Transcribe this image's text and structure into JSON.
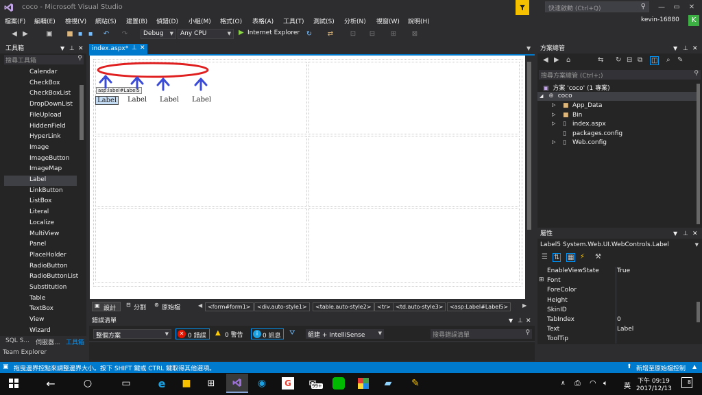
{
  "title": {
    "app": "coco - Microsoft Visual Studio",
    "quick_launch": "快速啟動 (Ctrl+Q)",
    "user": "kevin-16880",
    "user_initial": "K"
  },
  "menu": [
    "檔案(F)",
    "編輯(E)",
    "檢視(V)",
    "網站(S)",
    "建置(B)",
    "偵錯(D)",
    "小組(M)",
    "格式(O)",
    "表格(A)",
    "工具(T)",
    "測試(S)",
    "分析(N)",
    "視窗(W)",
    "說明(H)"
  ],
  "toolbar": {
    "config": "Debug",
    "platform": "Any CPU",
    "run": "Internet Explorer"
  },
  "toolbox": {
    "title": "工具箱",
    "search": "搜尋工具箱",
    "items": [
      "Calendar",
      "CheckBox",
      "CheckBoxList",
      "DropDownList",
      "FileUpload",
      "HiddenField",
      "HyperLink",
      "Image",
      "ImageButton",
      "ImageMap",
      "Label",
      "LinkButton",
      "ListBox",
      "Literal",
      "Localize",
      "MultiView",
      "Panel",
      "PlaceHolder",
      "RadioButton",
      "RadioButtonList",
      "Substitution",
      "Table",
      "TextBox",
      "View",
      "Wizard"
    ],
    "selected": "Label",
    "bottom_tabs": [
      "SQL S...",
      "伺服器...",
      "工具箱"
    ]
  },
  "editor": {
    "tab": "index.aspx*",
    "tag_label": "asp:label#Label5",
    "labels": [
      "Label",
      "Label",
      "Label",
      "Label"
    ],
    "view_tabs": [
      "設計",
      "分割",
      "原始檔"
    ],
    "breadcrumbs": [
      "<form#form1>",
      "<div.auto-style1>",
      "<table.auto-style2>",
      "<tr>",
      "<td.auto-style3>",
      "<asp:Label#Label5>"
    ]
  },
  "error_list": {
    "title": "錯誤清單",
    "scope": "整個方案",
    "errors": "0 錯誤",
    "warnings": "0 警告",
    "messages": "0 訊息",
    "build": "組建 + IntelliSense",
    "search": "搜尋錯誤清單"
  },
  "solution": {
    "title": "方案總管",
    "search": "搜尋方案總管 (Ctrl+;)",
    "root": "方案 'coco' (1 專案)",
    "project": "coco",
    "items": [
      "App_Data",
      "Bin",
      "index.aspx",
      "packages.config",
      "Web.config"
    ]
  },
  "properties": {
    "title": "屬性",
    "object": "Label5  System.Web.UI.WebControls.Label",
    "rows": [
      {
        "name": "EnableViewState",
        "value": "True"
      },
      {
        "name": "Font",
        "value": ""
      },
      {
        "name": "ForeColor",
        "value": ""
      },
      {
        "name": "Height",
        "value": ""
      },
      {
        "name": "SkinID",
        "value": ""
      },
      {
        "name": "TabIndex",
        "value": "0"
      },
      {
        "name": "Text",
        "value": "Label"
      },
      {
        "name": "ToolTip",
        "value": ""
      }
    ]
  },
  "team_explorer": "Team Explorer",
  "status": {
    "left": "拖曳邊界控點來調整邊界大小。按下 SHIFT 鍵或 CTRL 鍵取得其他選項。",
    "right": "新增至原始檔控制"
  },
  "taskbar": {
    "time": "下午 09:19",
    "date": "2017/12/13",
    "ime": "英",
    "badge": "99+",
    "notif": "8"
  },
  "colors": {
    "accent": "#007acc",
    "vs_purple": "#68217a",
    "annotation_red": "#e02020",
    "annotation_blue": "#3a4bd8"
  }
}
